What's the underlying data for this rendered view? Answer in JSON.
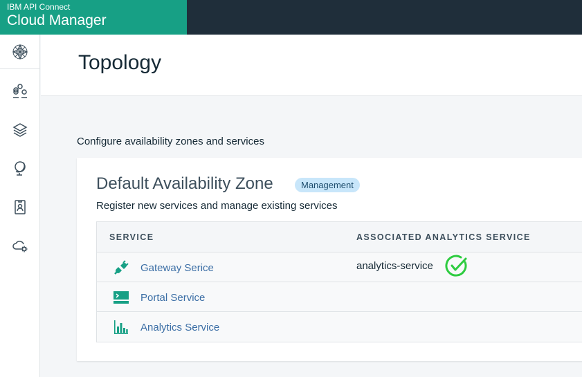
{
  "app": {
    "vendor": "IBM API Connect",
    "title": "Cloud Manager"
  },
  "sidebar": {
    "items": [
      {
        "icon": "topology-icon"
      },
      {
        "icon": "user-groups-icon"
      },
      {
        "icon": "layers-icon"
      },
      {
        "icon": "globe-icon"
      },
      {
        "icon": "badge-icon"
      },
      {
        "icon": "cloud-settings-icon"
      }
    ]
  },
  "page": {
    "title": "Topology",
    "subtitle": "Configure availability zones and services"
  },
  "zone": {
    "name": "Default Availability Zone",
    "badge": "Management",
    "description": "Register new services and manage existing services",
    "columns": [
      "SERVICE",
      "ASSOCIATED ANALYTICS SERVICE"
    ],
    "rows": [
      {
        "icon": "gateway-plug-icon",
        "name": "Gateway Serice",
        "analytics": "analytics-service",
        "status": "connected"
      },
      {
        "icon": "portal-terminal-icon",
        "name": "Portal Service",
        "analytics": "",
        "status": ""
      },
      {
        "icon": "analytics-bar-chart-icon",
        "name": "Analytics Service",
        "analytics": "",
        "status": ""
      }
    ]
  },
  "colors": {
    "brand": "#17a085",
    "topbar": "#1f2e3a",
    "link": "#3b6ea5",
    "success": "#2ecc40",
    "badge_bg": "#c8e6fa"
  }
}
